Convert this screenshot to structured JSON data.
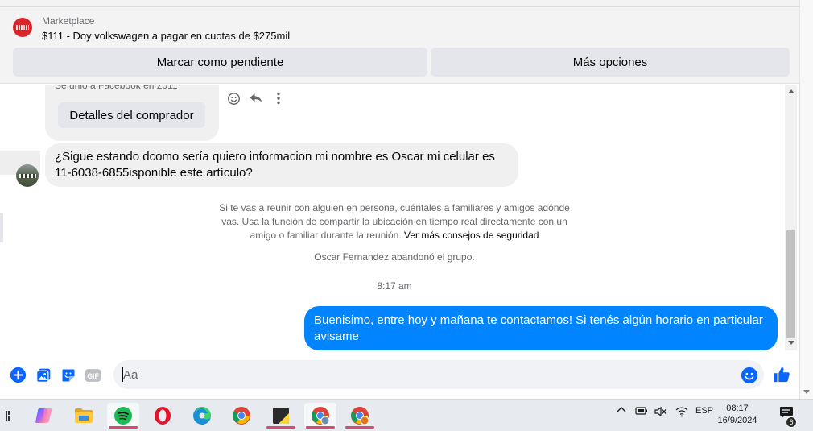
{
  "marketplace": {
    "label": "Marketplace",
    "listing_title": "$111 - Doy volkswagen a pagar en cuotas de $275mil",
    "mark_pending_label": "Marcar como pendiente",
    "more_options_label": "Más opciones"
  },
  "chat": {
    "buyer_joined": "Se unió a Facebook en 2011",
    "buyer_details_label": "Detalles del comprador",
    "incoming_message": "¿Sigue estando dcomo sería quiero informacion mi nombre es Oscar mi celular es 11-6038-6855isponible este artículo?",
    "safety_notice": "Si te vas a reunir con alguien en persona, cuéntales a familiares y amigos adónde vas. Usa la función de compartir la ubicación en tiempo real directamente con un amigo o familiar durante la reunión.",
    "safety_link": "Ver más consejos de seguridad",
    "system_message": "Oscar Fernandez abandonó el grupo.",
    "timestamp": "8:17 am",
    "outgoing_message": "Buenisimo, entre hoy y mañana te contactamos! Si tenés algún horario en particular avisame"
  },
  "composer": {
    "placeholder": "Aa",
    "gif_label": "GIF"
  },
  "taskbar": {
    "language": "ESP",
    "time": "08:17",
    "date": "16/9/2024",
    "notification_count": "6"
  },
  "colors": {
    "messenger_blue": "#0084ff",
    "bubble_grey": "#f0f0f0",
    "button_grey": "#e4e6eb"
  }
}
